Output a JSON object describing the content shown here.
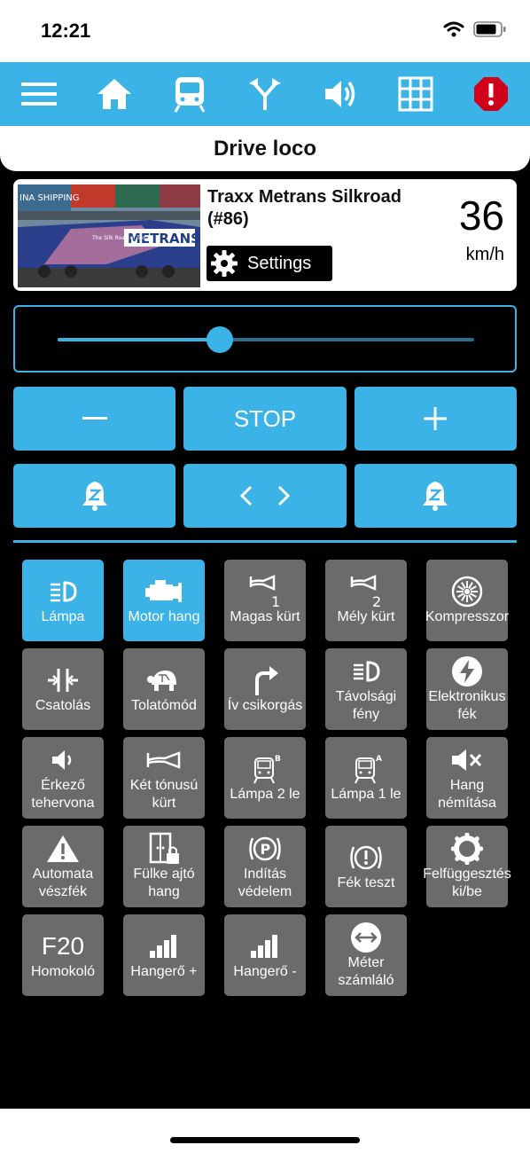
{
  "status": {
    "time": "12:21"
  },
  "toolbar": {
    "items": [
      "menu-icon",
      "home-icon",
      "train-icon",
      "turnout-icon",
      "speaker-icon",
      "grid-icon",
      "alert-icon"
    ],
    "alert_color": "#d0021b"
  },
  "title": "Drive loco",
  "loco": {
    "name": "Traxx Metrans Silkroad (#86)",
    "settings_label": "Settings",
    "speed": "36",
    "speed_unit": "km/h",
    "image_text": {
      "shipping": "INA SHIPPING",
      "brand": "METRANS",
      "tagline": "The Silk Road of Today"
    }
  },
  "throttle": {
    "level": 0.39
  },
  "controls": {
    "minus": "−",
    "stop": "STOP",
    "plus": "+",
    "direction_left": "<",
    "direction_right": ">"
  },
  "functions": [
    {
      "label": "Lámpa",
      "icon": "headlight-icon",
      "active": true
    },
    {
      "label": "Motor hang",
      "icon": "engine-icon",
      "active": true
    },
    {
      "label": "Magas kürt",
      "icon": "horn-1-icon",
      "active": false
    },
    {
      "label": "Mély kürt",
      "icon": "horn-2-icon",
      "active": false
    },
    {
      "label": "Kompresszor",
      "icon": "fan-icon",
      "active": false
    },
    {
      "label": "Csatolás",
      "icon": "coupling-icon",
      "active": false
    },
    {
      "label": "Tolatómód",
      "icon": "turtle-icon",
      "active": false
    },
    {
      "label": "Ív csikorgás",
      "icon": "curve-arrow-icon",
      "active": false
    },
    {
      "label": "Távolsági fény",
      "icon": "highbeam-icon",
      "active": false
    },
    {
      "label": "Elektronikus fék",
      "icon": "bolt-icon",
      "active": false
    },
    {
      "label": "Érkező tehervona",
      "icon": "speaker-small-icon",
      "active": false
    },
    {
      "label": "Két tónusú kürt",
      "icon": "horn-icon",
      "active": false
    },
    {
      "label": "Lámpa 2 le",
      "icon": "train-b-icon",
      "active": false
    },
    {
      "label": "Lámpa 1 le",
      "icon": "train-a-icon",
      "active": false
    },
    {
      "label": "Hang némítása",
      "icon": "mute-icon",
      "active": false
    },
    {
      "label": "Automata vészfék",
      "icon": "warning-icon",
      "active": false
    },
    {
      "label": "Fülke ajtó hang",
      "icon": "door-lock-icon",
      "active": false
    },
    {
      "label": "Indítás védelem",
      "icon": "parking-brake-icon",
      "active": false
    },
    {
      "label": "Fék teszt",
      "icon": "brake-icon",
      "active": false
    },
    {
      "label": "Felfüggesztés ki/be",
      "icon": "ring-icon",
      "active": false
    },
    {
      "label": "Homokoló",
      "icon": "F20",
      "active": false
    },
    {
      "label": "Hangerő +",
      "icon": "volume-up-icon",
      "active": false
    },
    {
      "label": "Hangerő -",
      "icon": "volume-down-icon",
      "active": false
    },
    {
      "label": "Méter számláló",
      "icon": "meter-icon",
      "active": false
    }
  ]
}
